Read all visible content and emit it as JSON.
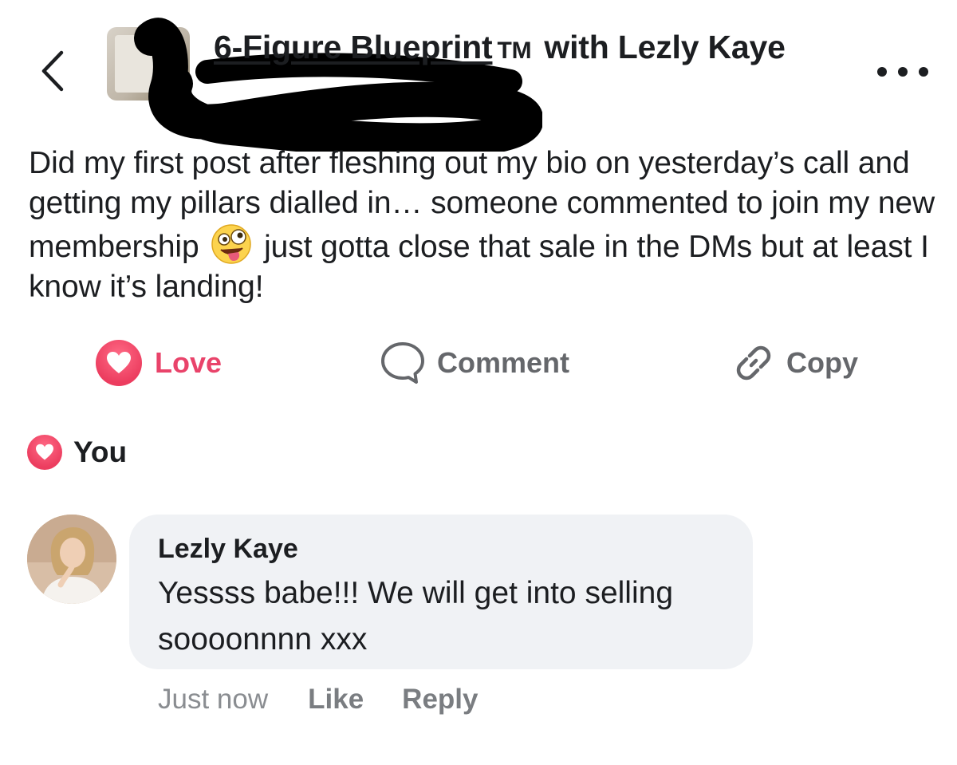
{
  "header": {
    "group_name_linked": "6-Figure Blueprint",
    "trademark": "TM",
    "group_name_suffix": "with Lezly Kaye"
  },
  "post": {
    "text_before_emoji": "Did my first post after fleshing out my bio on yesterday’s call and getting my pillars dialled in… someone commented to join my new membership",
    "emoji": "zany-face-emoji",
    "text_after_emoji": "just gotta close that sale in the DMs but at least I know it’s landing!"
  },
  "actions": {
    "love_label": "Love",
    "comment_label": "Comment",
    "copy_label": "Copy"
  },
  "reactions": {
    "summary": "You"
  },
  "comment": {
    "author": "Lezly Kaye",
    "text": "Yessss babe!!! We will get into selling soooonnnn xxx",
    "time": "Just now",
    "like_label": "Like",
    "reply_label": "Reply"
  },
  "colors": {
    "love": "#e9436a",
    "muted": "#65676b",
    "bubble": "#f0f2f5"
  }
}
